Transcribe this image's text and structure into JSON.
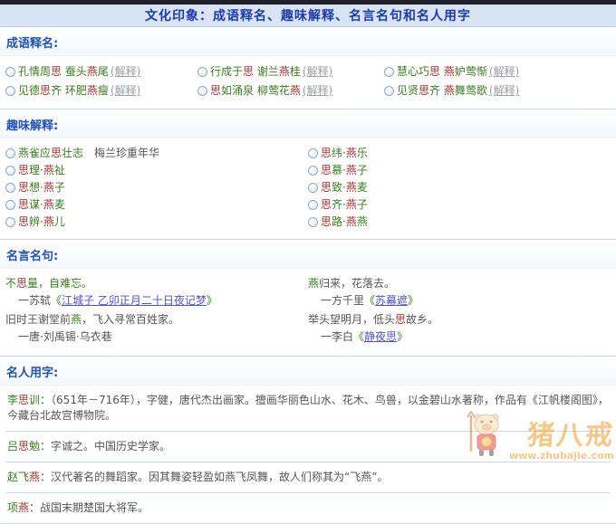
{
  "colors": {
    "green": "#3a7d1e",
    "red": "#a62f2f",
    "dark": "#555555",
    "link": "#5252cc",
    "header-blue": "#2050b8",
    "title-blue": "#1c3ab0",
    "title-bar-bg": "#d8e4f1",
    "top-bar": "#20202a",
    "divider": "#c7dcef",
    "explain": "#9aa0a6",
    "watermark-orange": "#f59a23"
  },
  "title": "文化印象：成语释名、趣味解释、名言名句和名人用字",
  "sections": {
    "chengyu": {
      "header": "成语释名:",
      "explain_label": "(解释)",
      "items": [
        [
          {
            "t": "孔情周",
            "c": "g"
          },
          {
            "t": "思",
            "c": "r"
          },
          {
            "t": " 蚕头",
            "c": "g"
          },
          {
            "t": "燕",
            "c": "r"
          },
          {
            "t": "尾",
            "c": "g"
          }
        ],
        [
          {
            "t": "见德",
            "c": "g"
          },
          {
            "t": "思",
            "c": "r"
          },
          {
            "t": "齐 环肥",
            "c": "g"
          },
          {
            "t": "燕",
            "c": "r"
          },
          {
            "t": "瘦",
            "c": "g"
          }
        ],
        [
          {
            "t": "行成于",
            "c": "g"
          },
          {
            "t": "思",
            "c": "r"
          },
          {
            "t": " 谢兰",
            "c": "g"
          },
          {
            "t": "燕",
            "c": "r"
          },
          {
            "t": "桂",
            "c": "g"
          }
        ],
        [
          {
            "t": "思",
            "c": "r"
          },
          {
            "t": "如涌泉 柳莺花",
            "c": "g"
          },
          {
            "t": "燕",
            "c": "r"
          }
        ],
        [
          {
            "t": "慧心巧",
            "c": "g"
          },
          {
            "t": "思",
            "c": "r"
          },
          {
            "t": " ",
            "c": "g"
          },
          {
            "t": "燕",
            "c": "r"
          },
          {
            "t": "妒莺惭",
            "c": "g"
          }
        ],
        [
          {
            "t": "见贤",
            "c": "g"
          },
          {
            "t": "思",
            "c": "r"
          },
          {
            "t": "齐 ",
            "c": "g"
          },
          {
            "t": "燕",
            "c": "r"
          },
          {
            "t": "舞莺歌",
            "c": "g"
          }
        ]
      ]
    },
    "quwei": {
      "header": "趣味解释:",
      "items": [
        [
          {
            "t": "燕雀应",
            "c": "g"
          },
          {
            "t": "思",
            "c": "r"
          },
          {
            "t": "壮志",
            "c": "g"
          },
          {
            "t": "　梅兰珍重年华",
            "c": "d"
          }
        ],
        [
          {
            "t": "思",
            "c": "r"
          },
          {
            "t": "理",
            "c": "g"
          },
          {
            "t": "·",
            "c": "d"
          },
          {
            "t": "燕",
            "c": "r"
          },
          {
            "t": "祉",
            "c": "g"
          }
        ],
        [
          {
            "t": "思",
            "c": "r"
          },
          {
            "t": "想",
            "c": "g"
          },
          {
            "t": "·",
            "c": "d"
          },
          {
            "t": "燕",
            "c": "r"
          },
          {
            "t": "子",
            "c": "g"
          }
        ],
        [
          {
            "t": "思",
            "c": "r"
          },
          {
            "t": "谋",
            "c": "g"
          },
          {
            "t": "·",
            "c": "d"
          },
          {
            "t": "燕",
            "c": "r"
          },
          {
            "t": "麦",
            "c": "g"
          }
        ],
        [
          {
            "t": "思",
            "c": "r"
          },
          {
            "t": "辨",
            "c": "g"
          },
          {
            "t": "·",
            "c": "d"
          },
          {
            "t": "燕",
            "c": "r"
          },
          {
            "t": "儿",
            "c": "g"
          }
        ],
        [
          {
            "t": "思",
            "c": "r"
          },
          {
            "t": "纬",
            "c": "g"
          },
          {
            "t": "·",
            "c": "d"
          },
          {
            "t": "燕",
            "c": "r"
          },
          {
            "t": "乐",
            "c": "g"
          }
        ],
        [
          {
            "t": "思",
            "c": "r"
          },
          {
            "t": "慕",
            "c": "g"
          },
          {
            "t": "·",
            "c": "d"
          },
          {
            "t": "燕",
            "c": "r"
          },
          {
            "t": "子",
            "c": "g"
          }
        ],
        [
          {
            "t": "思",
            "c": "r"
          },
          {
            "t": "致",
            "c": "g"
          },
          {
            "t": "·",
            "c": "d"
          },
          {
            "t": "燕",
            "c": "r"
          },
          {
            "t": "麦",
            "c": "g"
          }
        ],
        [
          {
            "t": "思",
            "c": "r"
          },
          {
            "t": "齐",
            "c": "g"
          },
          {
            "t": "·",
            "c": "d"
          },
          {
            "t": "燕",
            "c": "r"
          },
          {
            "t": "子",
            "c": "g"
          }
        ],
        [
          {
            "t": "思",
            "c": "r"
          },
          {
            "t": "路",
            "c": "g"
          },
          {
            "t": "·",
            "c": "d"
          },
          {
            "t": "燕",
            "c": "r"
          },
          {
            "t": "燕",
            "c": "g"
          }
        ]
      ]
    },
    "mingyan": {
      "header": "名言名句:",
      "quotes": [
        {
          "line": [
            {
              "t": "不",
              "c": "g"
            },
            {
              "t": "思",
              "c": "r"
            },
            {
              "t": "量，自难忘。",
              "c": "g"
            }
          ],
          "attr": [
            {
              "t": "一苏轼",
              "c": "d"
            },
            {
              "t": "《",
              "c": "g"
            },
            {
              "t": "江城子 乙卯正月二十日夜记梦",
              "c": "l"
            },
            {
              "t": "》",
              "c": "g"
            }
          ]
        },
        {
          "line": [
            {
              "t": "旧时王谢堂前",
              "c": "d"
            },
            {
              "t": "燕",
              "c": "g"
            },
            {
              "t": "，飞入寻常百姓家。",
              "c": "d"
            }
          ],
          "attr": [
            {
              "t": "一唐·刘禹锡·乌衣巷",
              "c": "d"
            }
          ]
        },
        {
          "line": [
            {
              "t": "燕",
              "c": "g"
            },
            {
              "t": "归来，花落去。",
              "c": "d"
            }
          ],
          "attr": [
            {
              "t": "一方千里",
              "c": "d"
            },
            {
              "t": "《",
              "c": "g"
            },
            {
              "t": "苏幕遮",
              "c": "l"
            },
            {
              "t": "》",
              "c": "g"
            }
          ]
        },
        {
          "line": [
            {
              "t": "举头望明月，低头",
              "c": "d"
            },
            {
              "t": "思",
              "c": "r"
            },
            {
              "t": "故乡。",
              "c": "d"
            }
          ],
          "attr": [
            {
              "t": "一李白",
              "c": "d"
            },
            {
              "t": "《",
              "c": "g"
            },
            {
              "t": "静夜思",
              "c": "l"
            },
            {
              "t": "》",
              "c": "g"
            }
          ]
        }
      ]
    },
    "mingren": {
      "header": "名人用字:",
      "entries": [
        [
          {
            "t": "李",
            "c": "g"
          },
          {
            "t": "思",
            "c": "r"
          },
          {
            "t": "训",
            "c": "g"
          },
          {
            "t": "：（651年－716年），字健，唐代杰出画家。擅画华丽色山水、花木、鸟兽，以金碧山水著称，作品有《江帆楼阁图》，今藏台北故宫博物院。",
            "c": "d"
          }
        ],
        [
          {
            "t": "吕",
            "c": "g"
          },
          {
            "t": "思",
            "c": "r"
          },
          {
            "t": "勉",
            "c": "g"
          },
          {
            "t": "：字诚之。中国历史学家。",
            "c": "d"
          }
        ],
        [
          {
            "t": "赵飞",
            "c": "g"
          },
          {
            "t": "燕",
            "c": "r"
          },
          {
            "t": "：汉代著名的舞蹈家。因其舞姿轻盈如燕飞凤舞，故人们称其为“飞燕”。",
            "c": "d"
          }
        ],
        [
          {
            "t": "项",
            "c": "g"
          },
          {
            "t": "燕",
            "c": "r"
          },
          {
            "t": "：战国末期楚国大将军。",
            "c": "d"
          }
        ]
      ]
    }
  },
  "watermark": {
    "brand": "猪八戒",
    "url_text": "www.zhubajie.com"
  }
}
